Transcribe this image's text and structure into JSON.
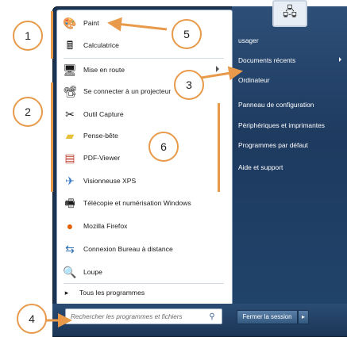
{
  "left_items": [
    {
      "label": "Paint",
      "icon": "paint-icon"
    },
    {
      "label": "Calculatrice",
      "icon": "calculator-icon"
    },
    {
      "label": "Mise en route",
      "icon": "getting-started-icon"
    },
    {
      "label": "Se connecter à un projecteur",
      "icon": "projector-icon"
    },
    {
      "label": "Outil Capture",
      "icon": "snipping-tool-icon"
    },
    {
      "label": "Pense-bête",
      "icon": "sticky-notes-icon"
    },
    {
      "label": "PDF-Viewer",
      "icon": "pdf-viewer-icon"
    },
    {
      "label": "Visionneuse XPS",
      "icon": "xps-viewer-icon"
    },
    {
      "label": "Télécopie et numérisation Windows",
      "icon": "fax-scan-icon"
    },
    {
      "label": "Mozilla Firefox",
      "icon": "firefox-icon"
    },
    {
      "label": "Connexion Bureau à distance",
      "icon": "remote-desktop-icon"
    },
    {
      "label": "Loupe",
      "icon": "magnifier-icon"
    }
  ],
  "all_programs": "Tous les programmes",
  "search": {
    "placeholder": "Rechercher les programmes et fichiers"
  },
  "right_items": [
    {
      "label": "usager"
    },
    {
      "label": "Documents récents"
    },
    {
      "label": "Ordinateur"
    },
    {
      "label": "Panneau de configuration"
    },
    {
      "label": "Périphériques et imprimantes"
    },
    {
      "label": "Programmes par défaut"
    },
    {
      "label": "Aide et support"
    }
  ],
  "shutdown": {
    "label": "Fermer la session",
    "arrow": "▸"
  },
  "callouts": [
    "1",
    "2",
    "3",
    "4",
    "5",
    "6"
  ],
  "colors": {
    "accent": "#e89a4a",
    "menu_blue": "#1a3352"
  }
}
